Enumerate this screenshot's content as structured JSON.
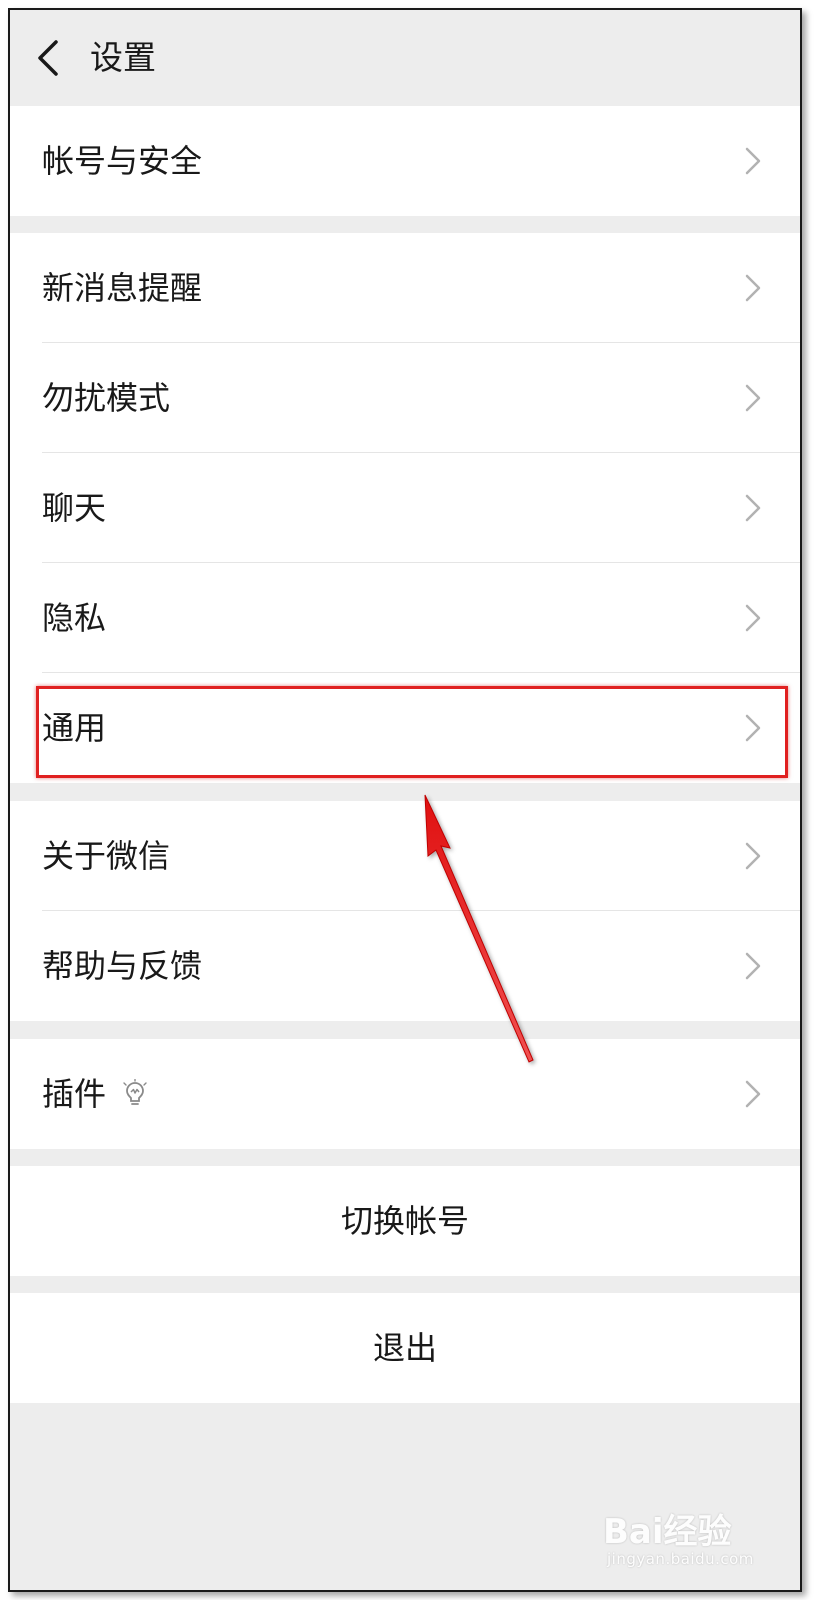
{
  "header": {
    "title": "设置",
    "back_icon": "chevron-left-icon"
  },
  "groups": {
    "account": {
      "items": [
        {
          "label": "帐号与安全"
        }
      ]
    },
    "main": {
      "items": [
        {
          "label": "新消息提醒"
        },
        {
          "label": "勿扰模式"
        },
        {
          "label": "聊天"
        },
        {
          "label": "隐私"
        },
        {
          "label": "通用"
        }
      ]
    },
    "about": {
      "items": [
        {
          "label": "关于微信"
        },
        {
          "label": "帮助与反馈"
        }
      ]
    },
    "plugins": {
      "items": [
        {
          "label": "插件",
          "badge_icon": "lightbulb-icon"
        }
      ]
    }
  },
  "actions": {
    "switch_account": "切换帐号",
    "logout": "退出"
  },
  "annotation": {
    "highlight_color": "#e02020",
    "highlighted_item": "通用"
  },
  "watermark": {
    "brand": "Bai经验",
    "url": "jingyan.baidu.com"
  }
}
